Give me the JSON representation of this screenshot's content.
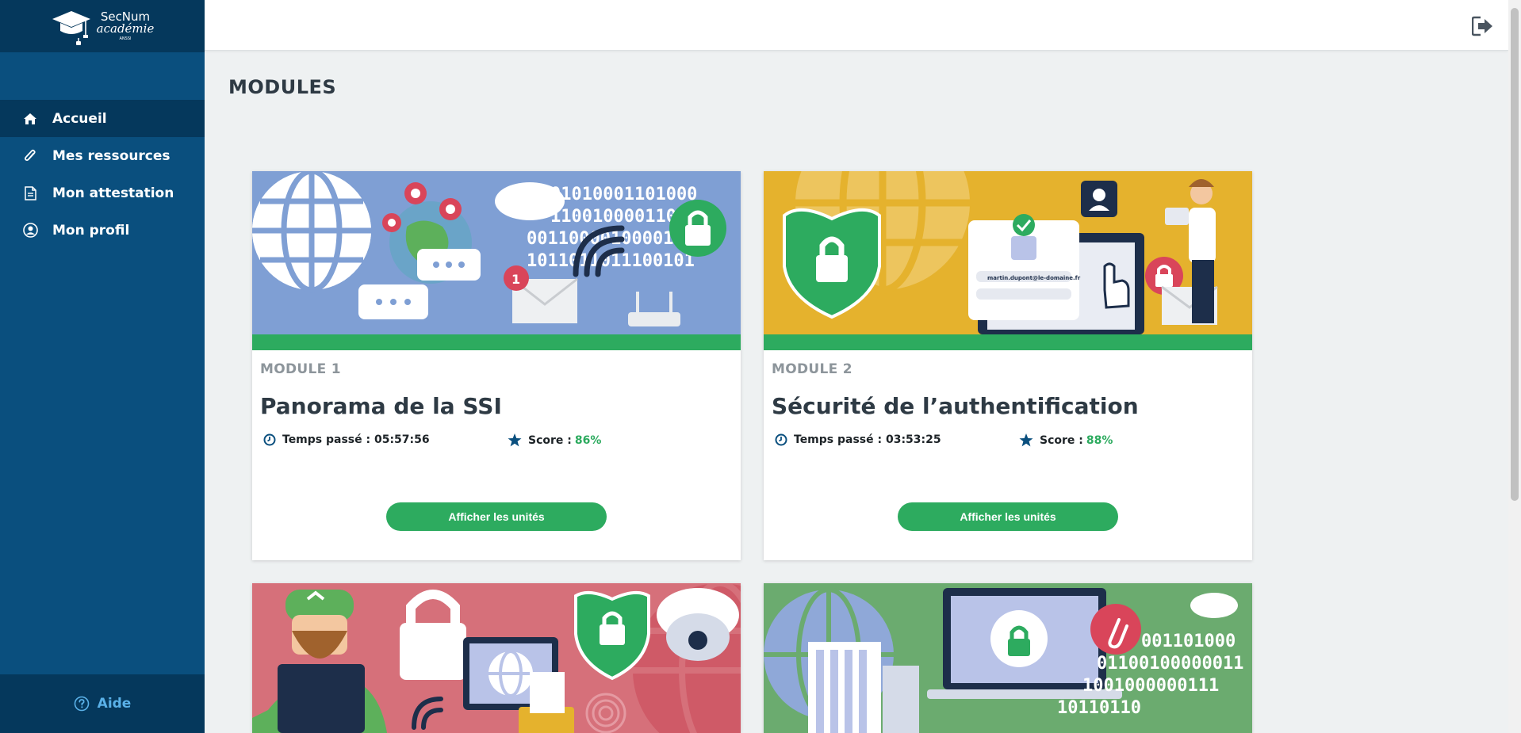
{
  "brand": {
    "name_line1": "SecNum",
    "name_line2": "académie",
    "name_line3": "ANSSI"
  },
  "sidebar": {
    "items": [
      {
        "label": "Accueil",
        "icon": "home-icon",
        "active": true
      },
      {
        "label": "Mes ressources",
        "icon": "paperclip-icon",
        "active": false
      },
      {
        "label": "Mon attestation",
        "icon": "document-icon",
        "active": false
      },
      {
        "label": "Mon profil",
        "icon": "user-circle-icon",
        "active": false
      }
    ],
    "help_label": "Aide"
  },
  "header": {
    "logout_icon": "logout-icon"
  },
  "main": {
    "title": "MODULES",
    "cards": [
      {
        "module_label": "MODULE 1",
        "title": "Panorama de la SSI",
        "time_label": "Temps passé : 05:57:56",
        "score_label": "Score :",
        "score_value": "86%",
        "button_label": "Afficher les unités",
        "banner_color": "#7f9fd4",
        "progress": 1.0
      },
      {
        "module_label": "MODULE 2",
        "title": "Sécurité de l’authentification",
        "time_label": "Temps passé : 03:53:25",
        "score_label": "Score :",
        "score_value": "88%",
        "button_label": "Afficher les unités",
        "banner_color": "#e5b22d",
        "progress": 1.0
      },
      {
        "banner_color": "#d6707a"
      },
      {
        "banner_color": "#6bab6f"
      }
    ]
  },
  "colors": {
    "sidebar": "#0a4f7e",
    "sidebar_dark": "#05385c",
    "accent_green": "#2dab5f",
    "help_blue": "#5ab1e8",
    "background": "#eef1f2"
  }
}
